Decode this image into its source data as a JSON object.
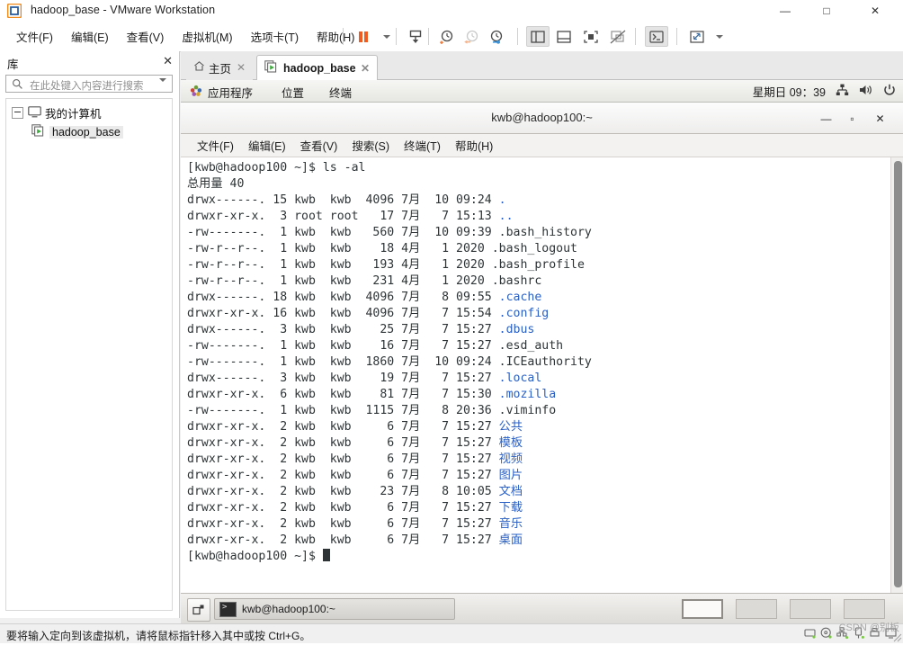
{
  "window": {
    "title": "hadoop_base - VMware Workstation",
    "app_icon": "vmware-icon",
    "controls": {
      "minimize": "—",
      "maximize": "□",
      "close": "✕"
    }
  },
  "menubar": {
    "items": [
      {
        "label": "文件(F)",
        "name": "menu-file"
      },
      {
        "label": "编辑(E)",
        "name": "menu-edit"
      },
      {
        "label": "查看(V)",
        "name": "menu-view"
      },
      {
        "label": "虚拟机(M)",
        "name": "menu-vm"
      },
      {
        "label": "选项卡(T)",
        "name": "menu-tabs"
      },
      {
        "label": "帮助(H)",
        "name": "menu-help"
      }
    ],
    "toolbar_icons": [
      "suspend-icon",
      "dropdown-caret-icon",
      "power-on-icon",
      "snapshot-take-icon",
      "snapshot-revert-icon",
      "snapshot-manager-icon",
      "show-library-icon",
      "show-console-icon",
      "fullscreen-icon",
      "unity-icon",
      "send-ctrl-alt-del-icon",
      "stretch-icon",
      "stretch-caret-icon"
    ]
  },
  "sidebar": {
    "title": "库",
    "close_icon": "close-icon",
    "search": {
      "placeholder": "在此处键入内容进行搜索",
      "value": "",
      "icon": "search-icon",
      "caret": "dropdown-caret-icon"
    },
    "tree": [
      {
        "label": "我的计算机",
        "icon": "computer-icon",
        "level": 0,
        "expanded": true,
        "selected": false
      },
      {
        "label": "hadoop_base",
        "icon": "vm-running-icon",
        "level": 1,
        "expanded": false,
        "selected": true
      }
    ]
  },
  "tabs": [
    {
      "label": "主页",
      "icon": "home-icon",
      "close_icon": "close-icon",
      "active": false
    },
    {
      "label": "hadoop_base",
      "icon": "vm-running-icon",
      "close_icon": "close-icon",
      "active": true
    }
  ],
  "gnome_panel": {
    "menus": [
      {
        "label": "应用程序",
        "icon": "gnome-apps-icon"
      },
      {
        "label": "位置",
        "icon": null
      },
      {
        "label": "终端",
        "icon": null
      }
    ],
    "clock": "星期日 09：39",
    "tray": [
      "network-icon",
      "volume-icon",
      "power-icon"
    ]
  },
  "terminal": {
    "title": "kwb@hadoop100:~",
    "controls": {
      "minimize": "—",
      "maximize": "▫",
      "close": "✕"
    },
    "menu": [
      "文件(F)",
      "编辑(E)",
      "查看(V)",
      "搜索(S)",
      "终端(T)",
      "帮助(H)"
    ],
    "lines": [
      {
        "text": "[kwb@hadoop100 ~]$ ls -al",
        "dir": null
      },
      {
        "text": "总用量 40",
        "dir": null
      },
      {
        "text": "drwx------. 15 kwb  kwb  4096 7月  10 09:24 ",
        "dir": "."
      },
      {
        "text": "drwxr-xr-x.  3 root root   17 7月   7 15:13 ",
        "dir": ".."
      },
      {
        "text": "-rw-------.  1 kwb  kwb   560 7月  10 09:39 .bash_history",
        "dir": null
      },
      {
        "text": "-rw-r--r--.  1 kwb  kwb    18 4月   1 2020 .bash_logout",
        "dir": null
      },
      {
        "text": "-rw-r--r--.  1 kwb  kwb   193 4月   1 2020 .bash_profile",
        "dir": null
      },
      {
        "text": "-rw-r--r--.  1 kwb  kwb   231 4月   1 2020 .bashrc",
        "dir": null
      },
      {
        "text": "drwx------. 18 kwb  kwb  4096 7月   8 09:55 ",
        "dir": ".cache"
      },
      {
        "text": "drwxr-xr-x. 16 kwb  kwb  4096 7月   7 15:54 ",
        "dir": ".config"
      },
      {
        "text": "drwx------.  3 kwb  kwb    25 7月   7 15:27 ",
        "dir": ".dbus"
      },
      {
        "text": "-rw-------.  1 kwb  kwb    16 7月   7 15:27 .esd_auth",
        "dir": null
      },
      {
        "text": "-rw-------.  1 kwb  kwb  1860 7月  10 09:24 .ICEauthority",
        "dir": null
      },
      {
        "text": "drwx------.  3 kwb  kwb    19 7月   7 15:27 ",
        "dir": ".local"
      },
      {
        "text": "drwxr-xr-x.  6 kwb  kwb    81 7月   7 15:30 ",
        "dir": ".mozilla"
      },
      {
        "text": "-rw-------.  1 kwb  kwb  1115 7月   8 20:36 .viminfo",
        "dir": null
      },
      {
        "text": "drwxr-xr-x.  2 kwb  kwb     6 7月   7 15:27 ",
        "dir": "公共"
      },
      {
        "text": "drwxr-xr-x.  2 kwb  kwb     6 7月   7 15:27 ",
        "dir": "模板"
      },
      {
        "text": "drwxr-xr-x.  2 kwb  kwb     6 7月   7 15:27 ",
        "dir": "视频"
      },
      {
        "text": "drwxr-xr-x.  2 kwb  kwb     6 7月   7 15:27 ",
        "dir": "图片"
      },
      {
        "text": "drwxr-xr-x.  2 kwb  kwb    23 7月   8 10:05 ",
        "dir": "文档"
      },
      {
        "text": "drwxr-xr-x.  2 kwb  kwb     6 7月   7 15:27 ",
        "dir": "下载"
      },
      {
        "text": "drwxr-xr-x.  2 kwb  kwb     6 7月   7 15:27 ",
        "dir": "音乐"
      },
      {
        "text": "drwxr-xr-x.  2 kwb  kwb     6 7月   7 15:27 ",
        "dir": "桌面"
      },
      {
        "text": "[kwb@hadoop100 ~]$ ",
        "dir": null,
        "cursor": true
      }
    ],
    "colors": {
      "fg": "#2e3436",
      "bg": "#ffffff",
      "dir": "#2b61c4"
    }
  },
  "gnome_taskbar": {
    "show_desktop_icon": "show-desktop-icon",
    "window_button": {
      "label": "kwb@hadoop100:~",
      "icon": "terminal-icon"
    },
    "workspaces": [
      {
        "name": "workspace-1",
        "active": true
      },
      {
        "name": "workspace-2",
        "active": false
      },
      {
        "name": "workspace-3",
        "active": false
      },
      {
        "name": "workspace-4",
        "active": false
      }
    ]
  },
  "statusbar": {
    "message": "要将输入定向到该虚拟机，请将鼠标指针移入其中或按 Ctrl+G。",
    "device_icons": [
      "hard-disk-icon",
      "cd-rom-icon",
      "network-adapter-icon",
      "usb-icon",
      "printer-icon",
      "display-icon"
    ],
    "watermark": "CSDN @别板"
  }
}
